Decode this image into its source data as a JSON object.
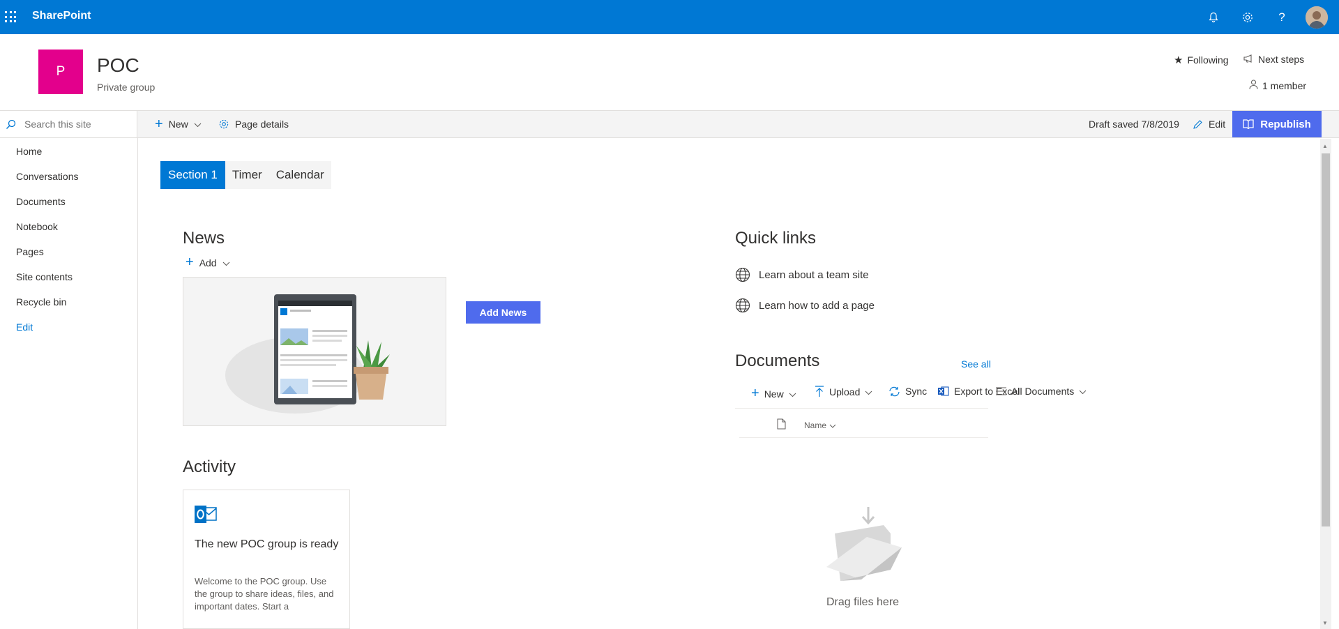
{
  "suite": {
    "brand": "SharePoint",
    "icons": [
      "waffle-icon",
      "bell-icon",
      "gear-icon",
      "help-icon",
      "avatar"
    ]
  },
  "site": {
    "logo_letter": "P",
    "title": "POC",
    "subtitle": "Private group",
    "following": "Following",
    "next_steps": "Next steps",
    "members": "1 member"
  },
  "commandbar": {
    "search_placeholder": "Search this site",
    "new": "New",
    "page_details": "Page details",
    "draft_status": "Draft saved 7/8/2019",
    "edit": "Edit",
    "republish": "Republish"
  },
  "nav": {
    "items": [
      "Home",
      "Conversations",
      "Documents",
      "Notebook",
      "Pages",
      "Site contents",
      "Recycle bin"
    ],
    "edit": "Edit"
  },
  "tabs": [
    "Section 1",
    "Timer",
    "Calendar"
  ],
  "news": {
    "heading": "News",
    "add": "Add",
    "add_news_button": "Add News"
  },
  "activity": {
    "heading": "Activity",
    "card_title": "The new POC group is ready",
    "card_body": "Welcome to the POC group. Use the group to share ideas, files, and important dates. Start a"
  },
  "quicklinks": {
    "heading": "Quick links",
    "links": [
      "Learn about a team site",
      "Learn how to add a page"
    ]
  },
  "documents": {
    "heading": "Documents",
    "see_all": "See all",
    "new": "New",
    "upload": "Upload",
    "sync": "Sync",
    "export": "Export to Excel",
    "view": "All Documents",
    "col_name": "Name",
    "empty_text": "Drag files here"
  },
  "colors": {
    "suitebar": "#0078d4",
    "logo": "#e3008c",
    "accent_button": "#4f6bed",
    "link": "#0078d4"
  }
}
